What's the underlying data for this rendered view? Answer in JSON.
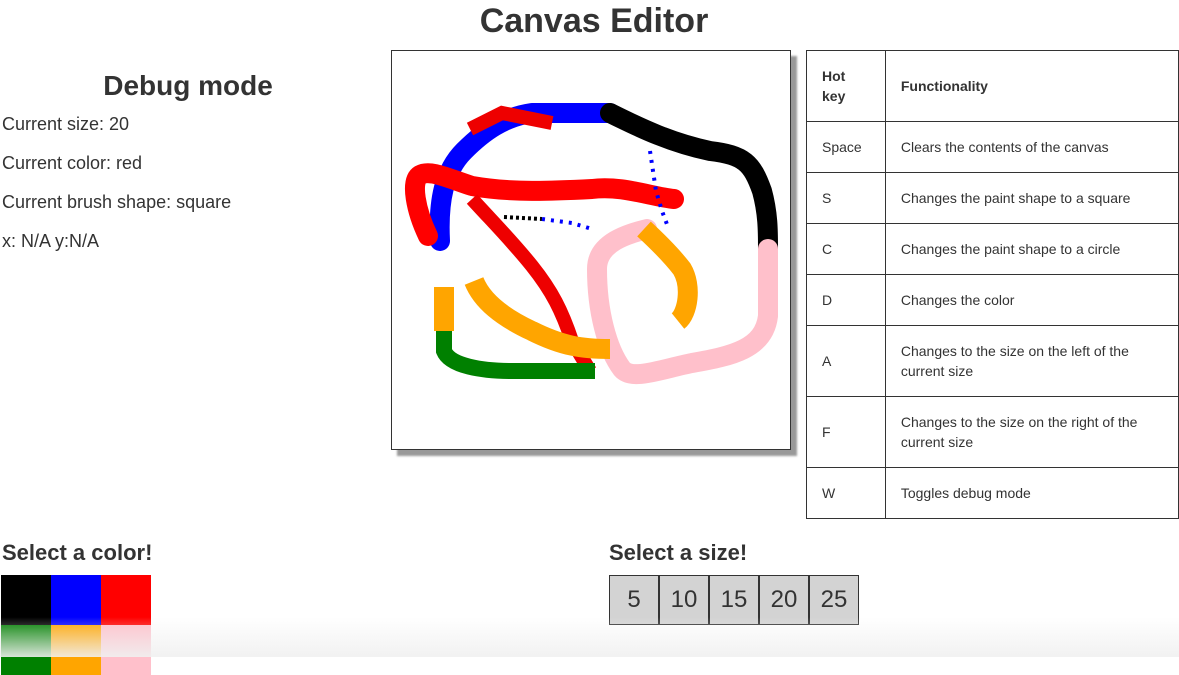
{
  "title": "Canvas Editor",
  "debug": {
    "heading": "Debug mode",
    "size_line": "Current size: 20",
    "color_line": "Current color: red",
    "shape_line": "Current brush shape: square",
    "coords_line": "x: N/A y:N/A"
  },
  "hotkeys": {
    "header_key": "Hot key",
    "header_func": "Functionality",
    "rows": [
      {
        "key": "Space",
        "func": "Clears the contents of the canvas"
      },
      {
        "key": "S",
        "func": "Changes the paint shape to a square"
      },
      {
        "key": "C",
        "func": "Changes the paint shape to a circle"
      },
      {
        "key": "D",
        "func": "Changes the color"
      },
      {
        "key": "A",
        "func": "Changes to the size on the left of the current size"
      },
      {
        "key": "F",
        "func": "Changes to the size on the right of the current size"
      },
      {
        "key": "W",
        "func": "Toggles debug mode"
      }
    ]
  },
  "colors": {
    "label": "Select a color!",
    "swatches": [
      {
        "name": "black",
        "hex": "#000000"
      },
      {
        "name": "blue",
        "hex": "#0000ff"
      },
      {
        "name": "red",
        "hex": "#ff0000"
      },
      {
        "name": "green",
        "hex": "#008000"
      },
      {
        "name": "orange",
        "hex": "#ffa500"
      },
      {
        "name": "pink",
        "hex": "#ffc0cb"
      }
    ]
  },
  "sizes": {
    "label": "Select a size!",
    "options": [
      "5",
      "10",
      "15",
      "20",
      "25"
    ]
  }
}
